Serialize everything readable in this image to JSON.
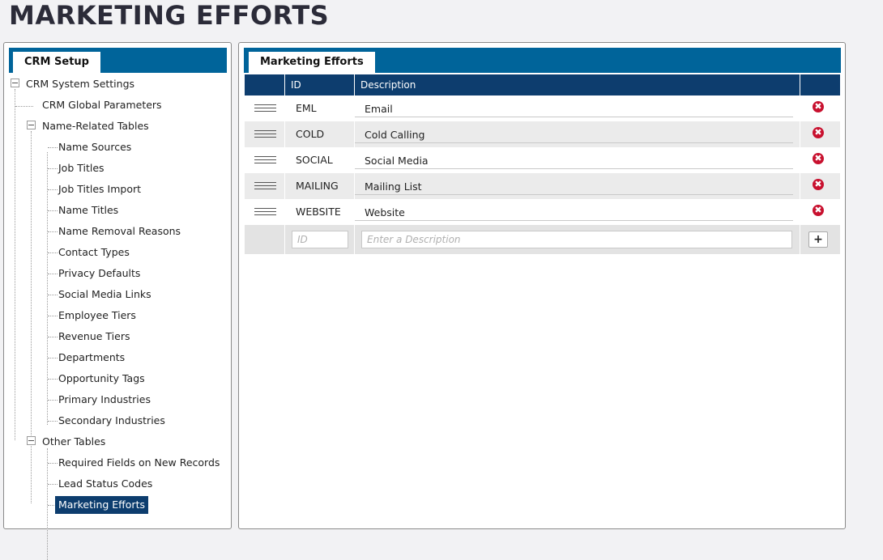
{
  "page": {
    "title": "MARKETING EFFORTS"
  },
  "left": {
    "tab": "CRM Setup",
    "tree": {
      "root": "CRM System Settings",
      "global": "CRM Global Parameters",
      "name_related": "Name-Related Tables",
      "name_related_items": [
        "Name Sources",
        "Job Titles",
        "Job Titles Import",
        "Name Titles",
        "Name Removal Reasons",
        "Contact Types",
        "Privacy Defaults",
        "Social Media Links",
        "Employee Tiers",
        "Revenue Tiers",
        "Departments",
        "Opportunity Tags",
        "Primary Industries",
        "Secondary Industries"
      ],
      "other": "Other Tables",
      "other_items": [
        "Required Fields on New Records",
        "Lead Status Codes",
        "Marketing Efforts"
      ]
    }
  },
  "right": {
    "tab": "Marketing Efforts",
    "columns": {
      "id": "ID",
      "description": "Description"
    },
    "rows": [
      {
        "id": "EML",
        "description": "Email"
      },
      {
        "id": "COLD",
        "description": "Cold Calling"
      },
      {
        "id": "SOCIAL",
        "description": "Social Media"
      },
      {
        "id": "MAILING",
        "description": "Mailing List"
      },
      {
        "id": "WEBSITE",
        "description": "Website"
      }
    ],
    "new_row": {
      "id_placeholder": "ID",
      "description_placeholder": "Enter a Description",
      "add_label": "+"
    },
    "delete_icon": "✖"
  },
  "colors": {
    "accent": "#00649a",
    "header": "#0d3d6e",
    "delete": "#c8102e"
  }
}
